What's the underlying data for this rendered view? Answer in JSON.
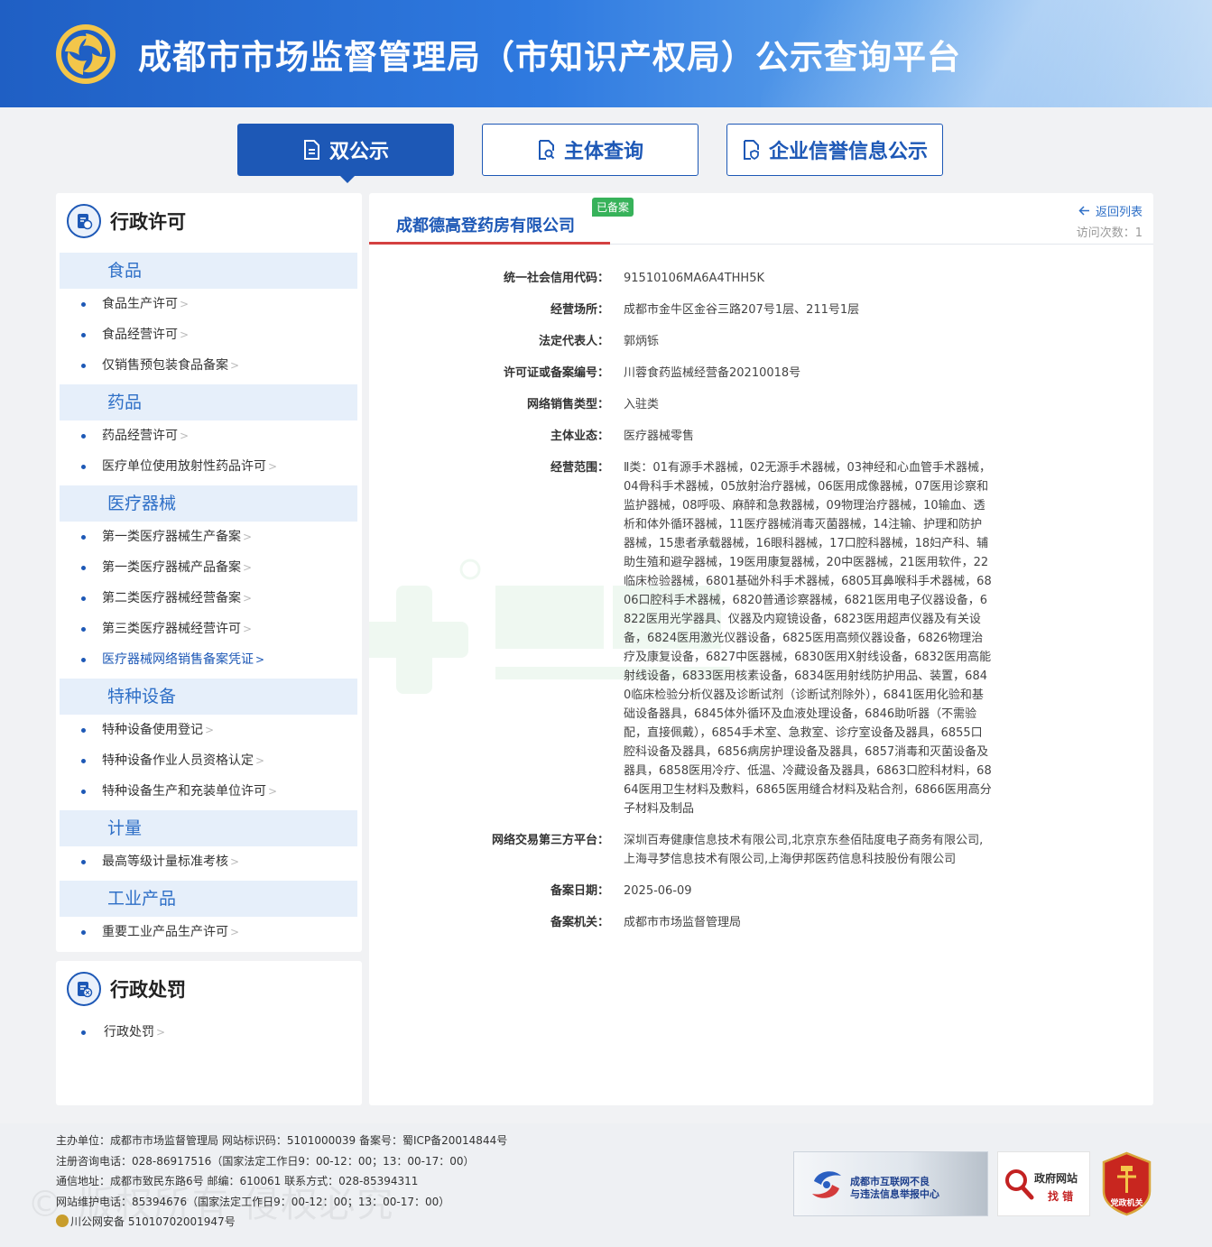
{
  "header": {
    "title": "成都市市场监督管理局（市知识产权局）公示查询平台"
  },
  "nav": {
    "tabs": [
      "双公示",
      "主体查询",
      "企业信誉信息公示"
    ]
  },
  "sidebar": {
    "license_title": "行政许可",
    "categories": [
      {
        "name": "食品",
        "items": [
          "食品生产许可",
          "食品经营许可",
          "仅销售预包装食品备案"
        ]
      },
      {
        "name": "药品",
        "items": [
          "药品经营许可",
          "医疗单位使用放射性药品许可"
        ]
      },
      {
        "name": "医疗器械",
        "items": [
          "第一类医疗器械生产备案",
          "第一类医疗器械产品备案",
          "第二类医疗器械经营备案",
          "第三类医疗器械经营许可",
          "医疗器械网络销售备案凭证"
        ]
      },
      {
        "name": "特种设备",
        "items": [
          "特种设备使用登记",
          "特种设备作业人员资格认定",
          "特种设备生产和充装单位许可"
        ]
      },
      {
        "name": "计量",
        "items": [
          "最高等级计量标准考核"
        ]
      },
      {
        "name": "工业产品",
        "items": [
          "重要工业产品生产许可"
        ]
      }
    ],
    "penalty_title": "行政处罚",
    "penalty_items": [
      "行政处罚"
    ]
  },
  "detail": {
    "company_name": "成都德高登药房有限公司",
    "badge": "已备案",
    "back_label": "返回列表",
    "visits": "访问次数：1",
    "fields": [
      {
        "label": "统一社会信用代码：",
        "value": "91510106MA6A4THH5K"
      },
      {
        "label": "经营场所：",
        "value": "成都市金牛区金谷三路207号1层、211号1层"
      },
      {
        "label": "法定代表人：",
        "value": "郭炳铄"
      },
      {
        "label": "许可证或备案编号：",
        "value": "川蓉食药监械经营备20210018号"
      },
      {
        "label": "网络销售类型：",
        "value": "入驻类"
      },
      {
        "label": "主体业态：",
        "value": "医疗器械零售"
      },
      {
        "label": "经营范围：",
        "value": "Ⅱ类：01有源手术器械，02无源手术器械，03神经和心血管手术器械，04骨科手术器械，05放射治疗器械，06医用成像器械，07医用诊察和监护器械，08呼吸、麻醉和急救器械，09物理治疗器械，10输血、透析和体外循环器械，11医疗器械消毒灭菌器械，14注输、护理和防护器械，15患者承载器械，16眼科器械，17口腔科器械，18妇产科、辅助生殖和避孕器械，19医用康复器械，20中医器械，21医用软件，22临床检验器械，6801基础外科手术器械，6805耳鼻喉科手术器械，6806口腔科手术器械，6820普通诊察器械，6821医用电子仪器设备，6822医用光学器具、仪器及内窥镜设备，6823医用超声仪器及有关设备，6824医用激光仪器设备，6825医用高频仪器设备，6826物理治疗及康复设备，6827中医器械，6830医用X射线设备，6832医用高能射线设备，6833医用核素设备，6834医用射线防护用品、装置，6840临床检验分析仪器及诊断试剂（诊断试剂除外），6841医用化验和基础设备器具，6845体外循环及血液处理设备，6846助听器（不需验配，直接佩戴），6854手术室、急救室、诊疗室设备及器具，6855口腔科设备及器具，6856病房护理设备及器具，6857消毒和灭菌设备及器具，6858医用冷疗、低温、冷藏设备及器具，6863口腔科材料，6864医用卫生材料及敷料，6865医用缝合材料及粘合剂，6866医用高分子材料及制品"
      },
      {
        "label": "网络交易第三方平台：",
        "value": "深圳百寿健康信息技术有限公司,北京京东叁佰陆度电子商务有限公司,上海寻梦信息技术有限公司,上海伊邦医药信息科技股份有限公司"
      },
      {
        "label": "备案日期：",
        "value": "2025-06-09"
      },
      {
        "label": "备案机关：",
        "value": "成都市市场监督管理局"
      }
    ]
  },
  "footer": {
    "lines": [
      "主办单位：成都市市场监督管理局 网站标识码：5101000039 备案号：蜀ICP备20014844号",
      "注册咨询电话：028-86917516（国家法定工作日9：00-12：00；13：00-17：00）",
      "通信地址：成都市致民东路6号 邮编：610061 联系方式：028-85394311",
      "网站维护电话：85394676（国家法定工作日9：00-12：00；13：00-17：00）",
      "川公网安备 51010702001947号"
    ],
    "banner_report_1": "成都市互联网不良",
    "banner_report_2": "与违法信息举报中心",
    "banner_gov_1": "政府网站",
    "banner_gov_2": "找 错",
    "banner_party": "党政机关"
  },
  "colors": {
    "primary": "#1d58b6",
    "accent_red": "#d44040",
    "badge_green": "#37b25a"
  }
}
